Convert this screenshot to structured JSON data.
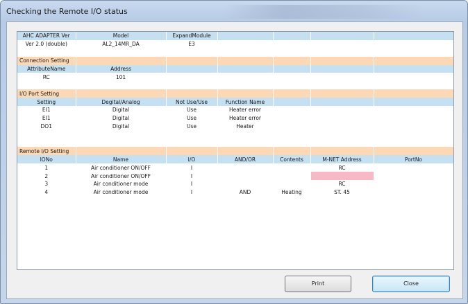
{
  "window": {
    "title": "Checking the Remote I/O status"
  },
  "adapter": {
    "headers": [
      "AHC ADAPTER Ver",
      "Model",
      "ExpandModule"
    ],
    "values": [
      "Ver 2.0 (double)",
      "AL2_14MR_DA",
      "E3"
    ]
  },
  "connection": {
    "section_label": "Connection Setting",
    "headers": [
      "AttributeName",
      "Address"
    ],
    "values": [
      "RC",
      "101"
    ]
  },
  "io_port": {
    "section_label": "I/O Port Setting",
    "headers": [
      "Setting",
      "Degital/Analog",
      "Not Use/Use",
      "Function Name"
    ],
    "rows": [
      [
        "EI1",
        "Digital",
        "Use",
        "Heater error"
      ],
      [
        "EI1",
        "Digital",
        "Use",
        "Heater error"
      ],
      [
        "DO1",
        "Digital",
        "Use",
        "Heater"
      ]
    ]
  },
  "remote_io": {
    "section_label": "Remote I/O Setting",
    "headers": [
      "IONo",
      "Name",
      "I/O",
      "AND/OR",
      "Contents",
      "M-NET Address",
      "PortNo"
    ],
    "rows": [
      [
        "1",
        "Air conditioner ON/OFF",
        "I",
        "",
        "",
        "RC",
        ""
      ],
      [
        "2",
        "Air conditioner ON/OFF",
        "I",
        "",
        "",
        "",
        ""
      ],
      [
        "3",
        "Air conditioner mode",
        "I",
        "",
        "",
        "RC",
        ""
      ],
      [
        "4",
        "Air conditioner mode",
        "I",
        "AND",
        "Heating",
        "ST. 45",
        ""
      ]
    ]
  },
  "buttons": {
    "print": "Print",
    "close": "Close"
  },
  "colors": {
    "section_bg": "#fcd9b4",
    "header_bg": "#c5e0f0",
    "error_cell": "#f7b9c6"
  }
}
